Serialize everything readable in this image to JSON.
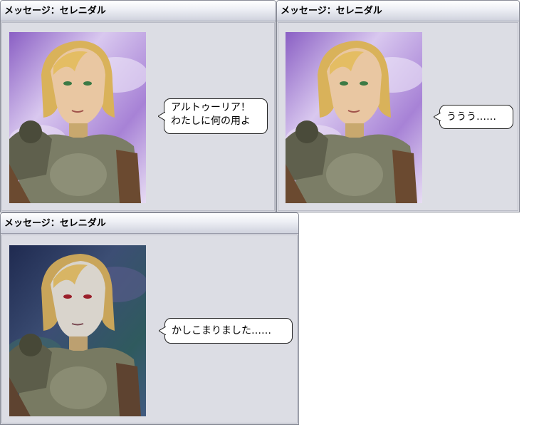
{
  "windows": [
    {
      "title": "メッセージ：セレニダル",
      "dialogue": [
        "アルトゥーリア！",
        "わたしに何の用よ"
      ],
      "variant": "normal"
    },
    {
      "title": "メッセージ：セレニダル",
      "dialogue": [
        "ううう……"
      ],
      "variant": "normal"
    },
    {
      "title": "メッセージ：セレニダル",
      "dialogue": [
        "かしこまりました……"
      ],
      "variant": "dark"
    }
  ],
  "colors": {
    "window_bg": "#dcdde4",
    "bg_light": "#b88fd8",
    "bg_dark": "#304a58",
    "hair": "#d9b25a",
    "armor": "#7b7d66"
  }
}
